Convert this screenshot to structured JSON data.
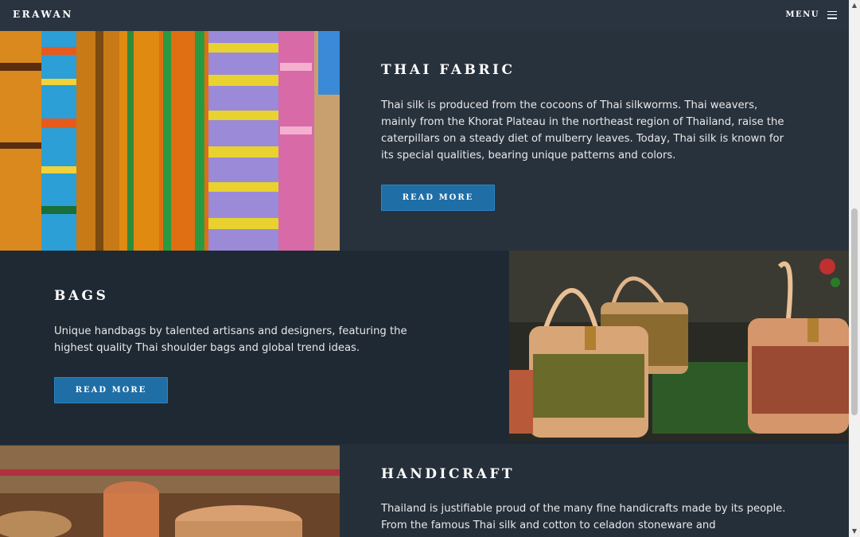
{
  "navbar": {
    "brand": "ERAWAN",
    "menu_label": "MENU",
    "menu_icon": "hamburger-icon"
  },
  "sections": [
    {
      "title": "THAI FABRIC",
      "description": "Thai silk is produced from the cocoons of Thai silkworms. Thai weavers, mainly from the Khorat Plateau in the northeast region of Thailand, raise the caterpillars on a steady diet of mulberry leaves. Today, Thai silk is known for its special qualities, bearing unique patterns and colors.",
      "button_label": "READ MORE",
      "image": "colorful-thai-silk-fabrics"
    },
    {
      "title": "BAGS",
      "description": "Unique handbags by talented artisans and designers, featuring the highest quality Thai shoulder bags and global trend ideas.",
      "button_label": "READ MORE",
      "image": "woven-thai-handbags"
    },
    {
      "title": "HANDICRAFT",
      "description": "Thailand is justifiable proud of the many fine handicrafts made by its people. From the famous Thai silk and cotton to celadon stoneware and",
      "image": "woven-baskets"
    }
  ],
  "colors": {
    "navbar_bg": "#2a3440",
    "page_bg": "#1f2a35",
    "button_bg": "#1f6ea6"
  }
}
